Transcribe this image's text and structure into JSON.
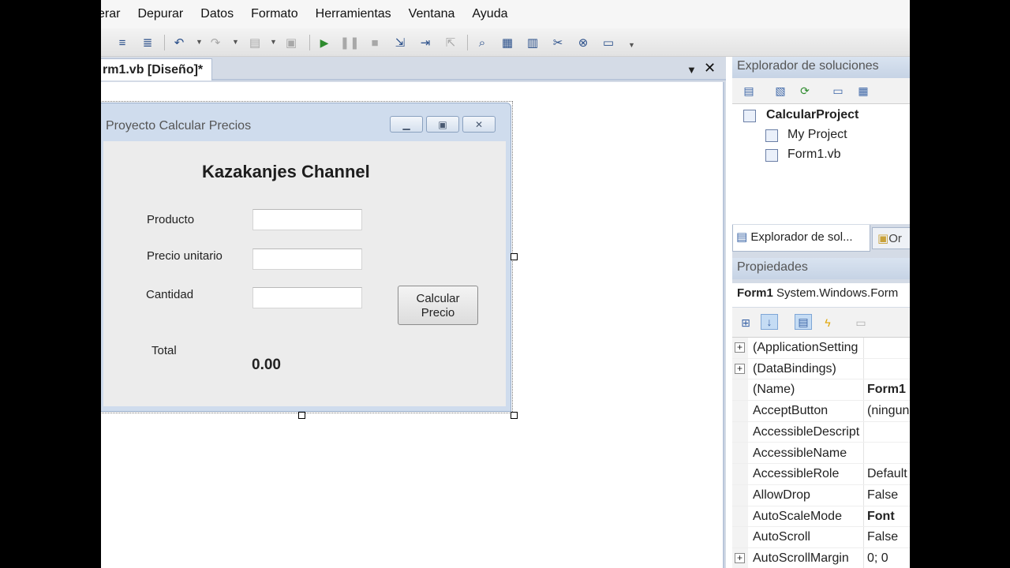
{
  "menu": [
    "erar",
    "Depurar",
    "Datos",
    "Formato",
    "Herramientas",
    "Ventana",
    "Ayuda"
  ],
  "tab": {
    "label": "rm1.vb [Diseño]*"
  },
  "designer_form": {
    "title": "Proyecto Calcular Precios",
    "heading": "Kazakanjes Channel",
    "labels": {
      "producto": "Producto",
      "precio": "Precio unitario",
      "cantidad": "Cantidad",
      "total": "Total"
    },
    "total_value": "0.00",
    "button_line1": "Calcular",
    "button_line2": "Precio"
  },
  "solution_explorer": {
    "header": "Explorador de soluciones",
    "tree": [
      "CalcularProject",
      "My Project",
      "Form1.vb"
    ],
    "tab1": "Explorador de sol...",
    "tab2": "Or"
  },
  "properties": {
    "header": "Propiedades",
    "object_name": "Form1",
    "object_type": "System.Windows.Form",
    "rows": [
      {
        "name": "(ApplicationSetting",
        "value": "",
        "expand": true,
        "bold": false
      },
      {
        "name": "(DataBindings)",
        "value": "",
        "expand": true,
        "bold": false
      },
      {
        "name": "(Name)",
        "value": "Form1",
        "expand": false,
        "bold": true
      },
      {
        "name": "AcceptButton",
        "value": "(ningun",
        "expand": false,
        "bold": false
      },
      {
        "name": "AccessibleDescript",
        "value": "",
        "expand": false,
        "bold": false
      },
      {
        "name": "AccessibleName",
        "value": "",
        "expand": false,
        "bold": false
      },
      {
        "name": "AccessibleRole",
        "value": "Default",
        "expand": false,
        "bold": false
      },
      {
        "name": "AllowDrop",
        "value": "False",
        "expand": false,
        "bold": false
      },
      {
        "name": "AutoScaleMode",
        "value": "Font",
        "expand": false,
        "bold": true
      },
      {
        "name": "AutoScroll",
        "value": "False",
        "expand": false,
        "bold": false
      },
      {
        "name": "AutoScrollMargin",
        "value": "0; 0",
        "expand": true,
        "bold": false
      }
    ]
  }
}
